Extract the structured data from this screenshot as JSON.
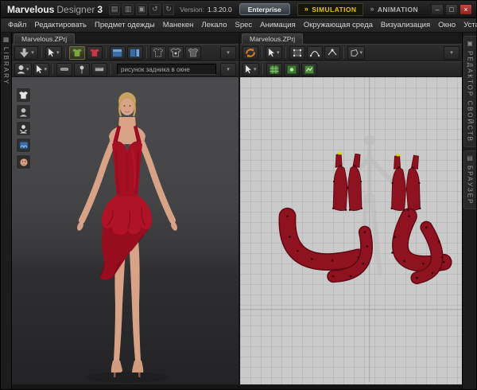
{
  "titlebar": {
    "brand": "Marvelous",
    "product": "Designer",
    "major": "3",
    "version_label": "Version:",
    "version_value": "1.3.20.0",
    "license_button": "Enterprise",
    "sim_tab": "SIMULATION",
    "anim_tab": "ANIMATION",
    "minimize": "–",
    "maximize": "□",
    "close": "×"
  },
  "menu": {
    "items": [
      "Файл",
      "Редактировать",
      "Предмет одежды",
      "Манекен",
      "Лекало",
      "Spec",
      "Анимация",
      "Окружающая среда",
      "Визуализация",
      "Окно",
      "Установка"
    ]
  },
  "rails": {
    "library": "LIBRARY",
    "property_editor": "РЕДАКТОР СВОЙСТВ",
    "browser": "БРАУЗЕР"
  },
  "view3d": {
    "tab": "Marvelous.ZPrj",
    "background_field": "рисунок задника в окне"
  },
  "view2d": {
    "tab": "Marvelous.ZPrj"
  },
  "glyphs": {
    "caret": "▾",
    "chevrons": "»",
    "rail_grid": "▦",
    "rail_props": "▣",
    "rail_browser": "▤",
    "titlebar_tools": [
      "▤",
      "▥",
      "▣",
      "↺",
      "↻"
    ]
  },
  "colors": {
    "accent_yellow": "#e3c000",
    "close_red": "#b8332b",
    "dress_red": "#a80f22",
    "pattern_red": "#8e1220",
    "sync_orange": "#e07818",
    "blue_icon": "#3a6ea5",
    "green_icon": "#3f7d32",
    "viewport3d_bg": "#3a3a3c",
    "viewport2d_bg": "#cacaca"
  }
}
